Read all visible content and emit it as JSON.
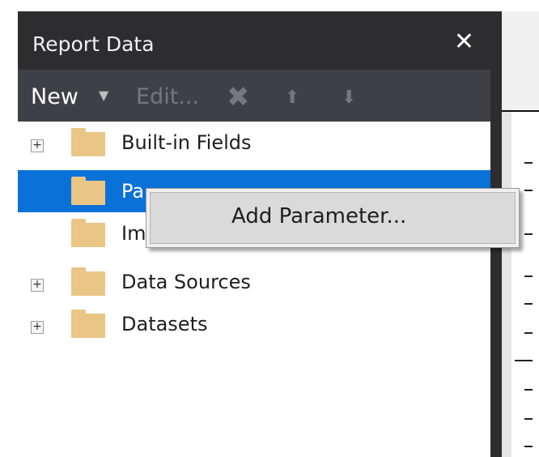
{
  "panel": {
    "title": "Report Data",
    "close_icon": "close-icon"
  },
  "toolbar": {
    "new_label": "New",
    "new_dropdown_icon": "caret-down-icon",
    "edit_label": "Edit...",
    "delete_icon": "delete-x-icon",
    "move_up_icon": "arrow-up-icon",
    "move_down_icon": "arrow-down-icon"
  },
  "tree": {
    "items": [
      {
        "label": "Built-in Fields",
        "expandable": true,
        "selected": false
      },
      {
        "label": "Pa",
        "expandable": false,
        "selected": true
      },
      {
        "label": "Im",
        "expandable": false,
        "selected": false
      },
      {
        "label": "Data Sources",
        "expandable": true,
        "selected": false
      },
      {
        "label": "Datasets",
        "expandable": true,
        "selected": false
      }
    ],
    "expander_symbol": "+"
  },
  "context_menu": {
    "items": [
      {
        "label": "Add Parameter..."
      }
    ]
  },
  "colors": {
    "titlebar_bg": "#2d2d30",
    "toolbar_bg": "#3f3f46",
    "selection": "#0a71d8",
    "folder": "#e9c586",
    "menu_bg": "#f0f0f0"
  }
}
